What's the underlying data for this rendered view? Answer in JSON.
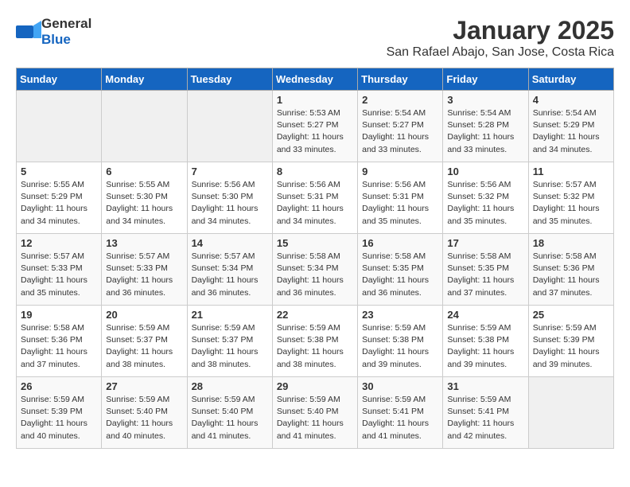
{
  "header": {
    "logo_general": "General",
    "logo_blue": "Blue",
    "title": "January 2025",
    "subtitle": "San Rafael Abajo, San Jose, Costa Rica"
  },
  "days_of_week": [
    "Sunday",
    "Monday",
    "Tuesday",
    "Wednesday",
    "Thursday",
    "Friday",
    "Saturday"
  ],
  "weeks": [
    [
      {
        "day": "",
        "info": ""
      },
      {
        "day": "",
        "info": ""
      },
      {
        "day": "",
        "info": ""
      },
      {
        "day": "1",
        "info": "Sunrise: 5:53 AM\nSunset: 5:27 PM\nDaylight: 11 hours\nand 33 minutes."
      },
      {
        "day": "2",
        "info": "Sunrise: 5:54 AM\nSunset: 5:27 PM\nDaylight: 11 hours\nand 33 minutes."
      },
      {
        "day": "3",
        "info": "Sunrise: 5:54 AM\nSunset: 5:28 PM\nDaylight: 11 hours\nand 33 minutes."
      },
      {
        "day": "4",
        "info": "Sunrise: 5:54 AM\nSunset: 5:29 PM\nDaylight: 11 hours\nand 34 minutes."
      }
    ],
    [
      {
        "day": "5",
        "info": "Sunrise: 5:55 AM\nSunset: 5:29 PM\nDaylight: 11 hours\nand 34 minutes."
      },
      {
        "day": "6",
        "info": "Sunrise: 5:55 AM\nSunset: 5:30 PM\nDaylight: 11 hours\nand 34 minutes."
      },
      {
        "day": "7",
        "info": "Sunrise: 5:56 AM\nSunset: 5:30 PM\nDaylight: 11 hours\nand 34 minutes."
      },
      {
        "day": "8",
        "info": "Sunrise: 5:56 AM\nSunset: 5:31 PM\nDaylight: 11 hours\nand 34 minutes."
      },
      {
        "day": "9",
        "info": "Sunrise: 5:56 AM\nSunset: 5:31 PM\nDaylight: 11 hours\nand 35 minutes."
      },
      {
        "day": "10",
        "info": "Sunrise: 5:56 AM\nSunset: 5:32 PM\nDaylight: 11 hours\nand 35 minutes."
      },
      {
        "day": "11",
        "info": "Sunrise: 5:57 AM\nSunset: 5:32 PM\nDaylight: 11 hours\nand 35 minutes."
      }
    ],
    [
      {
        "day": "12",
        "info": "Sunrise: 5:57 AM\nSunset: 5:33 PM\nDaylight: 11 hours\nand 35 minutes."
      },
      {
        "day": "13",
        "info": "Sunrise: 5:57 AM\nSunset: 5:33 PM\nDaylight: 11 hours\nand 36 minutes."
      },
      {
        "day": "14",
        "info": "Sunrise: 5:57 AM\nSunset: 5:34 PM\nDaylight: 11 hours\nand 36 minutes."
      },
      {
        "day": "15",
        "info": "Sunrise: 5:58 AM\nSunset: 5:34 PM\nDaylight: 11 hours\nand 36 minutes."
      },
      {
        "day": "16",
        "info": "Sunrise: 5:58 AM\nSunset: 5:35 PM\nDaylight: 11 hours\nand 36 minutes."
      },
      {
        "day": "17",
        "info": "Sunrise: 5:58 AM\nSunset: 5:35 PM\nDaylight: 11 hours\nand 37 minutes."
      },
      {
        "day": "18",
        "info": "Sunrise: 5:58 AM\nSunset: 5:36 PM\nDaylight: 11 hours\nand 37 minutes."
      }
    ],
    [
      {
        "day": "19",
        "info": "Sunrise: 5:58 AM\nSunset: 5:36 PM\nDaylight: 11 hours\nand 37 minutes."
      },
      {
        "day": "20",
        "info": "Sunrise: 5:59 AM\nSunset: 5:37 PM\nDaylight: 11 hours\nand 38 minutes."
      },
      {
        "day": "21",
        "info": "Sunrise: 5:59 AM\nSunset: 5:37 PM\nDaylight: 11 hours\nand 38 minutes."
      },
      {
        "day": "22",
        "info": "Sunrise: 5:59 AM\nSunset: 5:38 PM\nDaylight: 11 hours\nand 38 minutes."
      },
      {
        "day": "23",
        "info": "Sunrise: 5:59 AM\nSunset: 5:38 PM\nDaylight: 11 hours\nand 39 minutes."
      },
      {
        "day": "24",
        "info": "Sunrise: 5:59 AM\nSunset: 5:38 PM\nDaylight: 11 hours\nand 39 minutes."
      },
      {
        "day": "25",
        "info": "Sunrise: 5:59 AM\nSunset: 5:39 PM\nDaylight: 11 hours\nand 39 minutes."
      }
    ],
    [
      {
        "day": "26",
        "info": "Sunrise: 5:59 AM\nSunset: 5:39 PM\nDaylight: 11 hours\nand 40 minutes."
      },
      {
        "day": "27",
        "info": "Sunrise: 5:59 AM\nSunset: 5:40 PM\nDaylight: 11 hours\nand 40 minutes."
      },
      {
        "day": "28",
        "info": "Sunrise: 5:59 AM\nSunset: 5:40 PM\nDaylight: 11 hours\nand 41 minutes."
      },
      {
        "day": "29",
        "info": "Sunrise: 5:59 AM\nSunset: 5:40 PM\nDaylight: 11 hours\nand 41 minutes."
      },
      {
        "day": "30",
        "info": "Sunrise: 5:59 AM\nSunset: 5:41 PM\nDaylight: 11 hours\nand 41 minutes."
      },
      {
        "day": "31",
        "info": "Sunrise: 5:59 AM\nSunset: 5:41 PM\nDaylight: 11 hours\nand 42 minutes."
      },
      {
        "day": "",
        "info": ""
      }
    ]
  ]
}
